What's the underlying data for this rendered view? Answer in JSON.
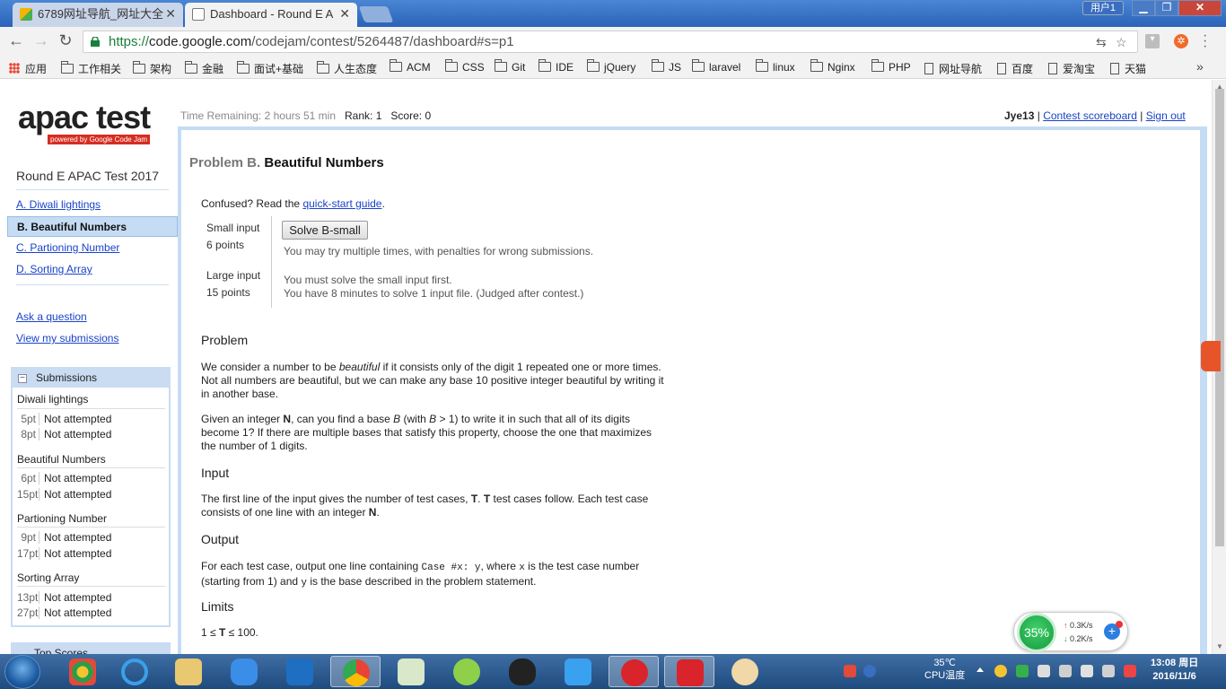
{
  "browser": {
    "tabs": [
      {
        "title": "6789网址导航_网址大全",
        "active": false
      },
      {
        "title": "Dashboard - Round E A",
        "active": true
      }
    ],
    "user_badge": "用户1",
    "url": {
      "scheme": "https://",
      "host": "code.google.com",
      "path": "/codejam/contest/5264487/dashboard#s=p1"
    },
    "bookmarks": [
      {
        "label": "应用",
        "icon": "apps-icon"
      },
      {
        "label": "工作相关",
        "icon": "folder-icon"
      },
      {
        "label": "架构",
        "icon": "folder-icon"
      },
      {
        "label": "金融",
        "icon": "folder-icon"
      },
      {
        "label": "面试+基础",
        "icon": "folder-icon"
      },
      {
        "label": "人生态度",
        "icon": "folder-icon"
      },
      {
        "label": "ACM",
        "icon": "folder-icon"
      },
      {
        "label": "CSS",
        "icon": "folder-icon"
      },
      {
        "label": "Git",
        "icon": "folder-icon"
      },
      {
        "label": "IDE",
        "icon": "folder-icon"
      },
      {
        "label": "jQuery",
        "icon": "folder-icon"
      },
      {
        "label": "JS",
        "icon": "folder-icon"
      },
      {
        "label": "laravel",
        "icon": "folder-icon"
      },
      {
        "label": "linux",
        "icon": "folder-icon"
      },
      {
        "label": "Nginx",
        "icon": "folder-icon"
      },
      {
        "label": "PHP",
        "icon": "folder-icon"
      },
      {
        "label": "网址导航",
        "icon": "page-icon"
      },
      {
        "label": "百度",
        "icon": "page-icon"
      },
      {
        "label": "爱淘宝",
        "icon": "page-icon"
      },
      {
        "label": "天猫",
        "icon": "page-icon"
      }
    ],
    "bookmarks_more": "»"
  },
  "sidebar": {
    "logo_text": "apac test",
    "logo_sub": "powered by Google Code Jam",
    "round_name": "Round E APAC Test 2017",
    "problems": [
      {
        "label": "A. Diwali lightings",
        "active": false
      },
      {
        "label": "B. Beautiful Numbers",
        "active": true
      },
      {
        "label": "C. Partioning Number",
        "active": false
      },
      {
        "label": "D. Sorting Array",
        "active": false
      }
    ],
    "links": [
      "Ask a question",
      "View my submissions"
    ],
    "submissions": {
      "title": "Submissions",
      "collapse_symbol": "−",
      "problems": [
        {
          "name": "Diwali lightings",
          "rows": [
            {
              "pt": "5pt",
              "status": "Not attempted"
            },
            {
              "pt": "8pt",
              "status": "Not attempted"
            }
          ]
        },
        {
          "name": "Beautiful Numbers",
          "rows": [
            {
              "pt": "6pt",
              "status": "Not attempted"
            },
            {
              "pt": "15pt",
              "status": "Not attempted"
            }
          ]
        },
        {
          "name": "Partioning Number",
          "rows": [
            {
              "pt": "9pt",
              "status": "Not attempted"
            },
            {
              "pt": "17pt",
              "status": "Not attempted"
            }
          ]
        },
        {
          "name": "Sorting Array",
          "rows": [
            {
              "pt": "13pt",
              "status": "Not attempted"
            },
            {
              "pt": "27pt",
              "status": "Not attempted"
            }
          ]
        }
      ]
    },
    "top_scores": "Top Scores"
  },
  "header": {
    "time_label": "Time Remaining:",
    "time_value": "2 hours 51 min",
    "rank_label": "Rank:",
    "rank_value": "1",
    "score_label": "Score:",
    "score_value": "0",
    "username": "Jye13",
    "scoreboard_link": "Contest scoreboard",
    "signout_link": "Sign out",
    "divider": "|"
  },
  "problem": {
    "prefix": "Problem B.",
    "title": "Beautiful Numbers",
    "confused_text": "Confused? Read the",
    "guide_link": "quick-start guide",
    "guide_suffix": ".",
    "small": {
      "label": "Small input",
      "points": "6 points",
      "button": "Solve B-small",
      "hint": "You may try multiple times, with penalties for wrong submissions."
    },
    "large": {
      "label": "Large input",
      "points": "15 points",
      "hint1": "You must solve the small input first.",
      "hint2": "You have 8 minutes to solve 1 input file. (Judged after contest.)"
    },
    "sections": {
      "problem_h": "Problem",
      "p1_a": "We consider a number to be ",
      "p1_em": "beautiful",
      "p1_b": " if it consists only of the digit 1 repeated one or more times. Not all numbers are beautiful, but we can make any base 10 positive integer beautiful by writing it in another base.",
      "p2_a": "Given an integer ",
      "p2_n": "N",
      "p2_b": ", can you find a base ",
      "p2_B": "B",
      "p2_c": " (with ",
      "p2_cond": "B",
      "p2_d": " > 1) to write it in such that all of its digits become 1? If there are multiple bases that satisfy this property, choose the one that maximizes the number of 1 digits.",
      "input_h": "Input",
      "in_a": "The first line of the input gives the number of test cases, ",
      "in_T": "T",
      "in_b": ". ",
      "in_T2": "T",
      "in_c": " test cases follow. Each test case consists of one line with an integer ",
      "in_N": "N",
      "in_d": ".",
      "output_h": "Output",
      "out_a": "For each test case, output one line containing ",
      "out_code": "Case #x: y",
      "out_b": ", where ",
      "out_x": "x",
      "out_c": " is the test case number (starting from 1) and ",
      "out_y": "y",
      "out_d": " is the base described in the problem statement.",
      "limits_h": "Limits",
      "lim_a": "1 ≤ ",
      "lim_T": "T",
      "lim_b": " ≤ 100."
    }
  },
  "gauge": {
    "percent": "35%",
    "up": "0.3K/s",
    "down": "0.2K/s"
  },
  "taskbar": {
    "temp": "35℃",
    "temp_label": "CPU温度",
    "time": "13:08 周日",
    "date": "2016/11/6"
  }
}
